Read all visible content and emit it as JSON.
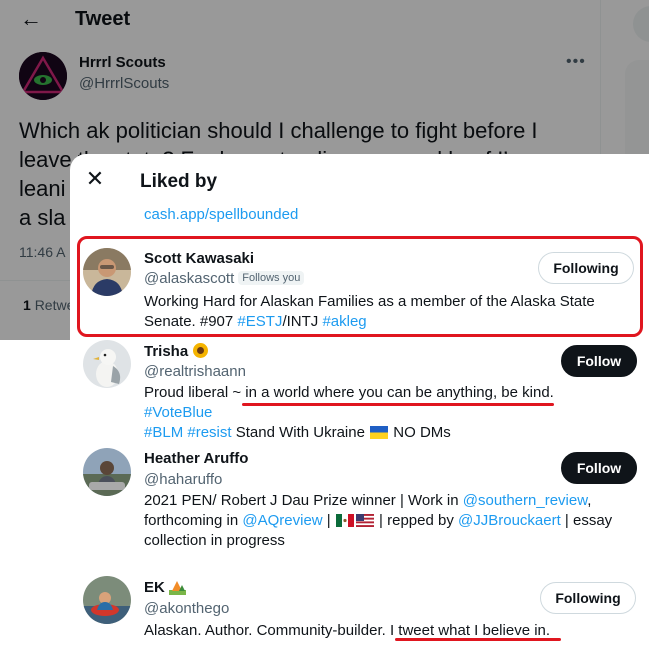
{
  "background": {
    "header_title": "Tweet",
    "author_name": "Hrrrl Scouts",
    "author_handle": "@HrrrlScouts",
    "tweet_text": "Which ak politician should I challenge to fight before I leave the state? For long-standing personal beef I’m leaning… a sla",
    "tweet_lines": [
      "Which ak politician should I challenge to fight before I",
      "leave the state? For long-standing personal beef I’m",
      "leani",
      "a sla"
    ],
    "time": "11:46 A",
    "retweets_count": "1",
    "retweets_label": "Retwe"
  },
  "modal": {
    "title": "Liked by",
    "previous_bio_link": "cash.app/spellbounded",
    "users": [
      {
        "name": "Scott Kawasaki",
        "handle": "@alaskascott",
        "follows_you": "Follows you",
        "button": "Following",
        "bio_a": "Working Hard for Alaskan Families as a member of the Alaska State",
        "bio_b": "Senate. #907 ",
        "bio_tag1": "#ESTJ",
        "bio_c": "/INTJ ",
        "bio_tag2": "#akleg"
      },
      {
        "name": "Trisha",
        "name_emoji": "sunflower-emoji",
        "handle": "@realtrishaann",
        "button": "Follow",
        "bio_a": "Proud liberal ~ in a world where you can be anything, be kind. ",
        "bio_tag1": "#VoteBlue",
        "bio_tag2": "#BLM",
        "bio_tag3": "#resist",
        "bio_b": " Stand With Ukraine ",
        "bio_flag": "ukraine-flag",
        "bio_c": " NO DMs"
      },
      {
        "name": "Heather Aruffo",
        "handle": "@haharuffo",
        "button": "Follow",
        "bio_a": "2021 PEN/ Robert J Dau Prize winner | Work in ",
        "bio_mention1": "@southern_review",
        "bio_b": ",",
        "bio_c": "forthcoming in ",
        "bio_mention2": "@AQreview",
        "bio_d": " | ",
        "bio_flags": [
          "mexico-flag",
          "usa-flag"
        ],
        "bio_e": " | repped by ",
        "bio_mention3": "@JJBrouckaert",
        "bio_f": " | essay",
        "bio_g": "collection in progress"
      },
      {
        "name": "EK",
        "name_emoji": "camping-emoji",
        "handle": "@akonthego",
        "button": "Following",
        "bio_a": "Alaskan. Author. Community-builder. I tweet what I believe in."
      }
    ]
  },
  "colors": {
    "link": "#1d9bf0",
    "annotation_red": "#e0161f",
    "follow_button_bg": "#0f1419",
    "secondary_text": "#536471"
  }
}
